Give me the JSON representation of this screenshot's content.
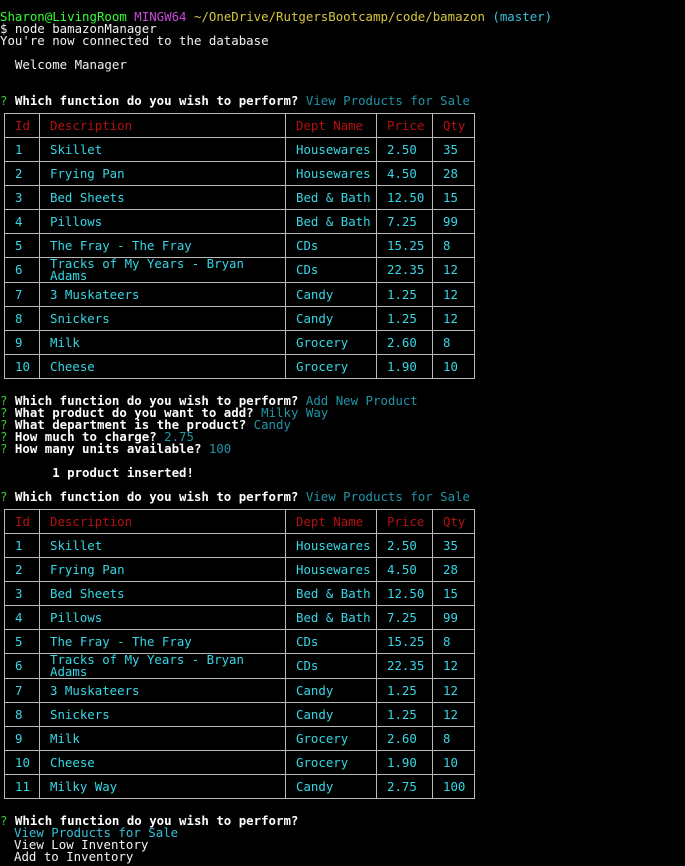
{
  "prompt": {
    "user": "Sharon@LivingRoom",
    "env": "MINGW64",
    "path": "~/OneDrive/RutgersBootcamp/code/bamazon",
    "branch": "(master)",
    "command": "$ node bamazonManager"
  },
  "messages": {
    "connected": "You're now connected to the database",
    "welcome": "  Welcome Manager",
    "inserted": "       1 product inserted!"
  },
  "q": {
    "mark": "? ",
    "which": "Which function do you wish to perform? ",
    "which_bare": "Which function do you wish to perform?",
    "what_product": "What product do you want to add? ",
    "what_dept": "What department is the product? ",
    "how_much": "How much to charge? ",
    "how_many": "How many units available? "
  },
  "answers": {
    "view_products": "View Products for Sale",
    "add_new_product": "Add New Product",
    "product_name": "Milky Way",
    "department": "Candy",
    "price": "2.75",
    "units": "100"
  },
  "menu": {
    "options": [
      "View Products for Sale",
      "View Low Inventory",
      "Add to Inventory"
    ]
  },
  "table": {
    "headers": [
      "Id",
      "Description",
      "Dept Name",
      "Price",
      "Qty"
    ],
    "rows_first": [
      [
        "1",
        "Skillet",
        "Housewares",
        "2.50",
        "35"
      ],
      [
        "2",
        "Frying Pan",
        "Housewares",
        "4.50",
        "28"
      ],
      [
        "3",
        "Bed Sheets",
        "Bed & Bath",
        "12.50",
        "15"
      ],
      [
        "4",
        "Pillows",
        "Bed & Bath",
        "7.25",
        "99"
      ],
      [
        "5",
        "The Fray - The Fray",
        "CDs",
        "15.25",
        "8"
      ],
      [
        "6",
        "Tracks of My Years - Bryan Adams",
        "CDs",
        "22.35",
        "12"
      ],
      [
        "7",
        "3 Muskateers",
        "Candy",
        "1.25",
        "12"
      ],
      [
        "8",
        "Snickers",
        "Candy",
        "1.25",
        "12"
      ],
      [
        "9",
        "Milk",
        "Grocery",
        "2.60",
        "8"
      ],
      [
        "10",
        "Cheese",
        "Grocery",
        "1.90",
        "10"
      ]
    ],
    "rows_second": [
      [
        "1",
        "Skillet",
        "Housewares",
        "2.50",
        "35"
      ],
      [
        "2",
        "Frying Pan",
        "Housewares",
        "4.50",
        "28"
      ],
      [
        "3",
        "Bed Sheets",
        "Bed & Bath",
        "12.50",
        "15"
      ],
      [
        "4",
        "Pillows",
        "Bed & Bath",
        "7.25",
        "99"
      ],
      [
        "5",
        "The Fray - The Fray",
        "CDs",
        "15.25",
        "8"
      ],
      [
        "6",
        "Tracks of My Years - Bryan Adams",
        "CDs",
        "22.35",
        "12"
      ],
      [
        "7",
        "3 Muskateers",
        "Candy",
        "1.25",
        "12"
      ],
      [
        "8",
        "Snickers",
        "Candy",
        "1.25",
        "12"
      ],
      [
        "9",
        "Milk",
        "Grocery",
        "2.60",
        "8"
      ],
      [
        "10",
        "Cheese",
        "Grocery",
        "1.90",
        "10"
      ],
      [
        "11",
        "Milky Way",
        "Candy",
        "2.75",
        "100"
      ]
    ]
  }
}
